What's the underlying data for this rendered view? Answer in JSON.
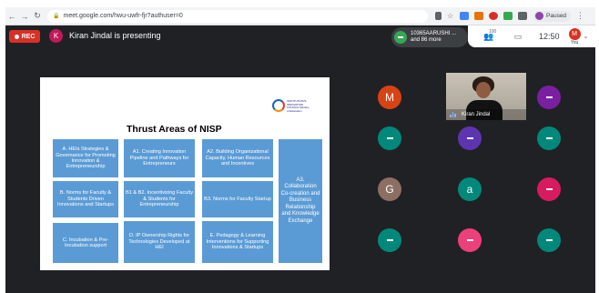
{
  "browser": {
    "back_icon": "back-arrow-icon",
    "forward_icon": "forward-arrow-icon",
    "reload_icon": "reload-icon",
    "url": "meet.google.com/hwu-uwfr-fjr?authuser=0",
    "paused_label": "Paused"
  },
  "meet": {
    "rec_label": "REC",
    "presenter_initial": "K",
    "presenting_text": "Kiran Jindal is presenting",
    "pill_line1": "10365AARUSHI ...",
    "pill_line2": "and 86 more",
    "people_count": "100",
    "clock": "12:50",
    "you_initial": "M",
    "you_label": "You"
  },
  "slide": {
    "title": "Thrust Areas of NISP",
    "logo_text": "INSTITUTION'S INNOVATION COUNCIL Ministry of Education",
    "boxes": [
      "A. HEIs Strategies & Governance for Promoting Innovation & Entrepreneurship",
      "A1. Creating Innovation Pipeline and Pathways for Entrepreneurs",
      "A2. Building Organizational Capacity, Human Resources and Incentives",
      "A3. Collaboration Co-creation and Business Relationship and Knowledge Exchange",
      "B. Norms for Faculty & Students Driven Innovations and Startups",
      "B1 & B2. Incentivizing Faculty & Students for Entrepreneurship",
      "B3. Norms for Faculty Startup",
      "C. Incubation & Pre- Incubation support",
      "D. IP Ownership Rights for Technologies Developed at HEI",
      "E. Pedagogy & Learning Interventions for Supporting Innovations & Startups"
    ]
  },
  "participants": {
    "tiles": [
      {
        "initial": "M",
        "color": "#d84315"
      },
      {
        "initial": "",
        "color": "#7b1fa2"
      },
      {
        "initial": "",
        "color": "#00897b"
      },
      {
        "initial": "",
        "color": "#5e35b1"
      },
      {
        "initial": "",
        "color": "#00897b"
      },
      {
        "initial": "G",
        "color": "#8d6e63"
      },
      {
        "initial": "a",
        "color": "#00897b"
      },
      {
        "initial": "",
        "color": "#d81b60"
      },
      {
        "initial": "",
        "color": "#00897b"
      },
      {
        "initial": "",
        "color": "#ec407a"
      },
      {
        "initial": "",
        "color": "#00897b"
      }
    ],
    "video_name": "Kiran Jindal"
  },
  "colors": {
    "meet_bg": "#202124",
    "rec_red": "#d93025",
    "slide_box_blue": "#5b9bd5"
  }
}
